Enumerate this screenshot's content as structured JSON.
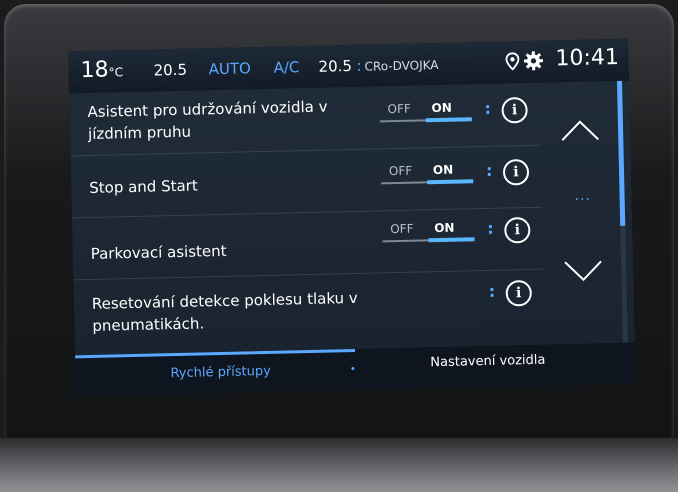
{
  "status": {
    "temp_left": "18",
    "temp_unit": "°C",
    "fan_left": "20.5",
    "auto": "AUTO",
    "ac": "A/C",
    "fan_right": "20.5",
    "station": "CRo-DVOJKA",
    "clock": "10:41"
  },
  "settings": [
    {
      "label": "Asistent pro udržování vozidla v jízdním pruhu",
      "off": "OFF",
      "on": "ON",
      "state": "on"
    },
    {
      "label": "Stop and Start",
      "off": "OFF",
      "on": "ON",
      "state": "on"
    },
    {
      "label": "Parkovací asistent",
      "off": "OFF",
      "on": "ON",
      "state": "on"
    },
    {
      "label": "Resetování detekce poklesu tlaku v pneumatikách.",
      "state": "none"
    }
  ],
  "info_symbol": "i",
  "menu_separator": ":",
  "scroll_dots": "...",
  "tabs": {
    "quick": "Rychlé přístupy",
    "vehicle_settings": "Nastavení vozidla"
  },
  "colors": {
    "accent": "#5aa8ff",
    "background": "#1a2430",
    "statusbar": "#1e2a38"
  },
  "icons": {
    "location": "location-pin-icon",
    "settings": "gear-icon",
    "info": "info-icon",
    "scroll_up": "chevron-up-icon",
    "scroll_down": "chevron-down-icon"
  }
}
